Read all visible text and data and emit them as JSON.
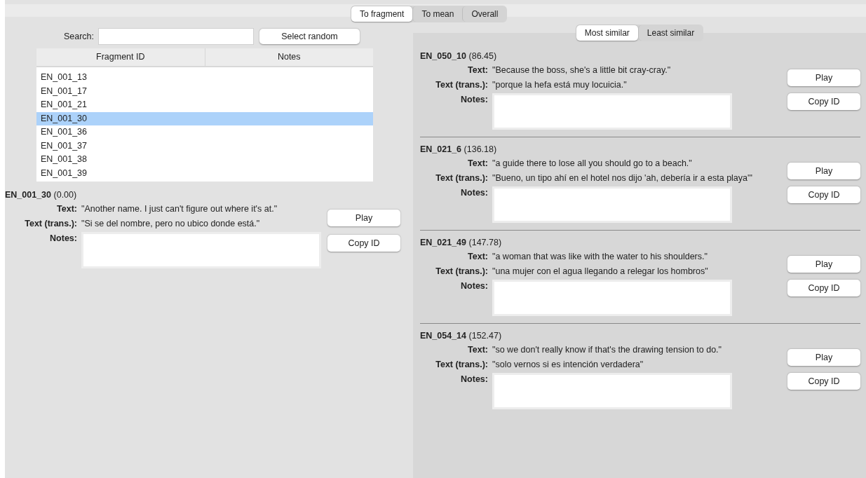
{
  "mode_tabs": [
    {
      "label": "To fragment",
      "selected": true
    },
    {
      "label": "To mean",
      "selected": false
    },
    {
      "label": "Overall",
      "selected": false
    }
  ],
  "search": {
    "label": "Search:",
    "button": "Select random"
  },
  "table": {
    "columns": [
      "Fragment ID",
      "Notes"
    ],
    "rows": [
      {
        "id": "EN_001_13",
        "selected": false
      },
      {
        "id": "EN_001_17",
        "selected": false
      },
      {
        "id": "EN_001_21",
        "selected": false
      },
      {
        "id": "EN_001_30",
        "selected": true
      },
      {
        "id": "EN_001_36",
        "selected": false
      },
      {
        "id": "EN_001_37",
        "selected": false
      },
      {
        "id": "EN_001_38",
        "selected": false
      },
      {
        "id": "EN_001_39",
        "selected": false
      }
    ]
  },
  "detail": {
    "id": "EN_001_30",
    "score": "(0.00)",
    "text_label": "Text:",
    "text": "\"Another name. I just can't figure out where it's at.\"",
    "trans_label": "Text (trans.):",
    "trans": "\"Si se del nombre, pero no ubico donde está.\"",
    "notes_label": "Notes:",
    "buttons": [
      "Play",
      "Copy ID"
    ]
  },
  "similarity_tabs": [
    {
      "label": "Most similar",
      "selected": true
    },
    {
      "label": "Least similar",
      "selected": false
    }
  ],
  "matches": [
    {
      "id": "EN_050_10",
      "score": "(86.45)",
      "text_label": "Text:",
      "text": "\"Because the boss, she's a little bit cray-cray.\"",
      "trans_label": "Text (trans.):",
      "trans": "\"porque la hefa está muy locuicia.\"",
      "notes_label": "Notes:",
      "buttons": [
        "Play",
        "Copy ID"
      ]
    },
    {
      "id": "EN_021_6",
      "score": "(136.18)",
      "text_label": "Text:",
      "text": "\"a guide there to lose all you should go to a beach.\"",
      "trans_label": "Text (trans.):",
      "trans": "\"Bueno, un tipo ahí en el hotel nos dijo 'ah, debería ir a esta playa'\"",
      "notes_label": "Notes:",
      "buttons": [
        "Play",
        "Copy ID"
      ]
    },
    {
      "id": "EN_021_49",
      "score": "(147.78)",
      "text_label": "Text:",
      "text": "\"a woman that was like with the water to his shoulders.\"",
      "trans_label": "Text (trans.):",
      "trans": "\"una mujer con el agua llegando a relegar los hombros\"",
      "notes_label": "Notes:",
      "buttons": [
        "Play",
        "Copy ID"
      ]
    },
    {
      "id": "EN_054_14",
      "score": "(152.47)",
      "text_label": "Text:",
      "text": "\"so we don't really know if that's the drawing tension to do.\"",
      "trans_label": "Text (trans.):",
      "trans": "\"solo vernos si es intención verdadera\"",
      "notes_label": "Notes:",
      "buttons": [
        "Play",
        "Copy ID"
      ]
    }
  ]
}
